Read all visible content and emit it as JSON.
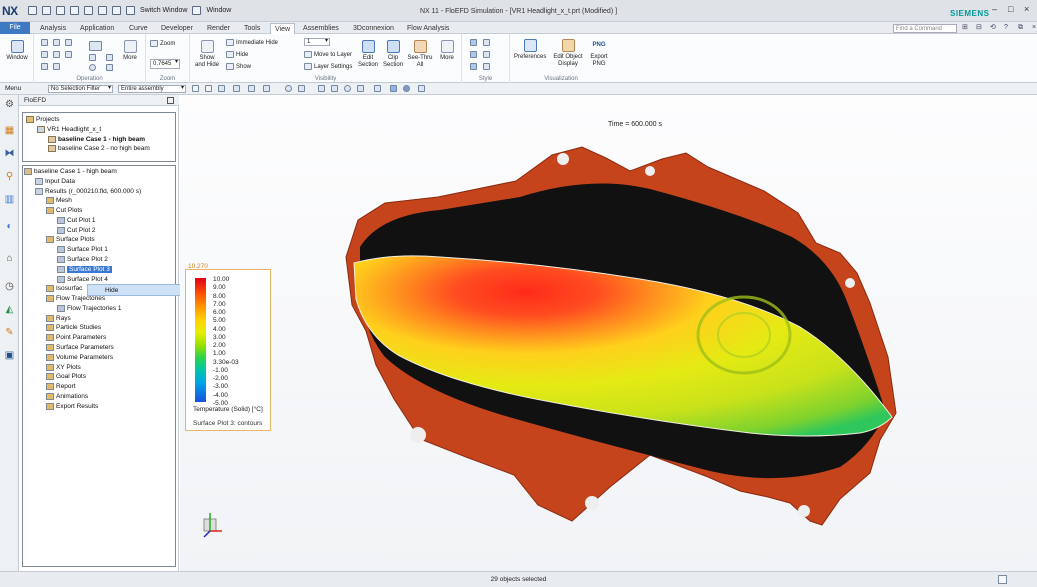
{
  "app": {
    "logo": "NX",
    "window_title": "NX 11 - FloEFD Simulation - [VR1 Headlight_x_t.prt (Modified) ]",
    "brand": "SIEMENS",
    "switch_window": "Switch Window",
    "window_menu": "Window"
  },
  "tabs": [
    "File",
    "Analysis",
    "Application",
    "Curve",
    "Developer",
    "Render",
    "Tools",
    "View",
    "Assemblies",
    "3Dconnexion",
    "Flow Analysis"
  ],
  "active_tab": "View",
  "find_command_placeholder": "Find a Command",
  "ribbon": {
    "window_label": "Window",
    "groups": {
      "operation": "Operation",
      "zoom": "Zoom",
      "visibility": "Visibility",
      "style": "Style",
      "visualization": "Visualization"
    },
    "more": "More",
    "zoom_label": "Zoom",
    "zoom_value": "0.7645",
    "show_and_hide": "Show and Hide",
    "immediate_hide": "Immediate Hide",
    "hide": "Hide",
    "show": "Show",
    "layer_value": "1",
    "move_to_layer": "Move to Layer",
    "layer_settings": "Layer Settings",
    "edit_section": "Edit Section",
    "clip_section": "Clip Section",
    "see_thru_all": "See-Thru All",
    "preferences": "Preferences",
    "edit_object_display": "Edit Object Display",
    "export_png_icon": "PNG",
    "export_png": "Export PNG"
  },
  "cmdbar": {
    "menu": "Menu",
    "selection_filter": "No Selection Filter",
    "assembly_scope": "Entire assembly"
  },
  "nav": {
    "title": "FloEFD",
    "projects_tree": [
      {
        "label": "Projects",
        "level": 0,
        "bold": false
      },
      {
        "label": "VR1 Headlight_x_t",
        "level": 1,
        "bold": false
      },
      {
        "label": "baseline Case 1 - high beam",
        "level": 2,
        "bold": true
      },
      {
        "label": "baseline Case 2 - no high beam",
        "level": 2,
        "bold": false
      }
    ],
    "results_tree": [
      {
        "label": "baseline Case 1 - high beam",
        "level": 0
      },
      {
        "label": "Input Data",
        "level": 1
      },
      {
        "label": "Results (r_000210.fld, 600.000 s)",
        "level": 1
      },
      {
        "label": "Mesh",
        "level": 2
      },
      {
        "label": "Cut Plots",
        "level": 2
      },
      {
        "label": "Cut Plot 1",
        "level": 3
      },
      {
        "label": "Cut Plot 2",
        "level": 3
      },
      {
        "label": "Surface Plots",
        "level": 2
      },
      {
        "label": "Surface Plot 1",
        "level": 3
      },
      {
        "label": "Surface Plot 2",
        "level": 3
      },
      {
        "label": "Surface Plot 3",
        "level": 3,
        "selected": true
      },
      {
        "label": "Surface Plot 4",
        "level": 3
      },
      {
        "label": "Isosurfac",
        "level": 2
      },
      {
        "label": "Flow Trajectories",
        "level": 2
      },
      {
        "label": "Flow Trajectories 1",
        "level": 3
      },
      {
        "label": "Rays",
        "level": 2
      },
      {
        "label": "Particle Studies",
        "level": 2
      },
      {
        "label": "Point Parameters",
        "level": 2
      },
      {
        "label": "Surface Parameters",
        "level": 2
      },
      {
        "label": "Volume Parameters",
        "level": 2
      },
      {
        "label": "XY Plots",
        "level": 2
      },
      {
        "label": "Goal Plots",
        "level": 2
      },
      {
        "label": "Report",
        "level": 2
      },
      {
        "label": "Animations",
        "level": 2
      },
      {
        "label": "Export Results",
        "level": 2
      }
    ],
    "context_menu_item": "Hide"
  },
  "viewport": {
    "time_label": "Time = 600.000 s",
    "legend": {
      "top_value": "10.270",
      "values": [
        "10.00",
        "9.00",
        "8.00",
        "7.00",
        "6.00",
        "5.00",
        "4.00",
        "3.00",
        "2.00",
        "1.00",
        "3.30e-03",
        "-1.00",
        "-2.00",
        "-3.00",
        "-4.00",
        "-5.00"
      ],
      "units": "Temperature (Solid) [°C]",
      "plot_name": "Surface Plot 3: contours"
    }
  },
  "status": {
    "text": "29 objects selected"
  },
  "colors": {
    "housing": "#c5401a",
    "accent": "#3a78d4",
    "brand": "#009999"
  }
}
